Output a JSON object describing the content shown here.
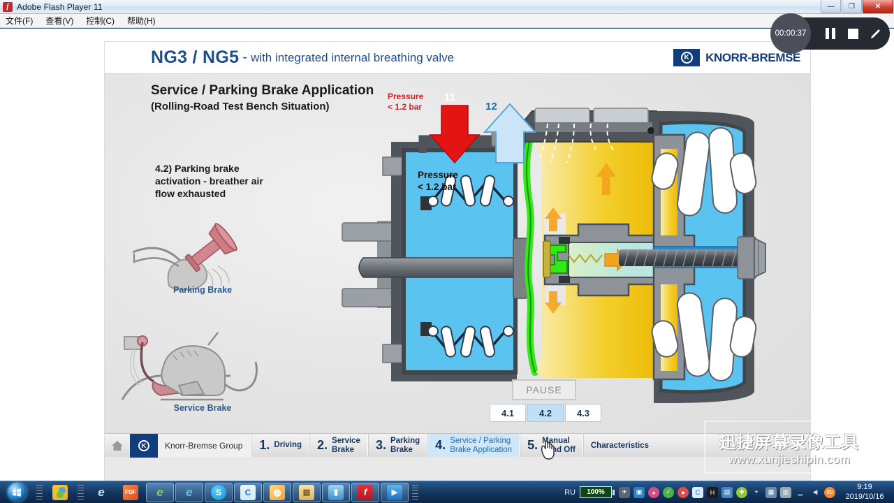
{
  "window": {
    "title": "Adobe Flash Player 11",
    "app_icon": "flash-icon",
    "minimize": "—",
    "maximize": "❐",
    "close": "✕",
    "menu": [
      "文件(F)",
      "查看(V)",
      "控制(C)",
      "帮助(H)"
    ]
  },
  "slide": {
    "header": {
      "ng": "NG3 / NG5",
      "dash": "-",
      "subtitle": "with integrated internal breathing valve",
      "brand_mark": "K",
      "brand_text": "KNORR-BREMSE"
    },
    "title_main": "Service / Parking Brake Application",
    "title_sub": "(Rolling-Road Test Bench Situation)",
    "note": "4.2) Parking brake activation - breather air flow exhausted",
    "parking_brake_label": "Parking Brake",
    "service_brake_label": "Service Brake",
    "pressure_red": "Pressure\n< 1.2 bar",
    "pressure_red_line1": "Pressure",
    "pressure_red_line2": "< 1.2 bar",
    "pressure_black_line1": "Pressure",
    "pressure_black_line2": "< 1.2 bar",
    "port_11": "11",
    "port_12": "12",
    "pause_label": "PAUSE",
    "subtabs": [
      {
        "label": "4.1",
        "active": false
      },
      {
        "label": "4.2",
        "active": true
      },
      {
        "label": "4.3",
        "active": false
      }
    ],
    "colors": {
      "header_blue": "#1f4e8c",
      "brand_blue": "#123d7c",
      "chamber_blue": "#5bc3f0",
      "chamber_yellow": "#f2c20c",
      "membrane_green": "#35e81a",
      "arrow_red": "#e21414",
      "arrow_blue": "#a8d8f5",
      "body_grey": "#5a6066"
    }
  },
  "navbar": {
    "home_icon": "home-icon",
    "brand_mark": "K",
    "brand": "Knorr-Bremse Group",
    "items": [
      {
        "num": "1.",
        "line1": "Driving",
        "line2": "",
        "active": false
      },
      {
        "num": "2.",
        "line1": "Service",
        "line2": "Brake",
        "active": false
      },
      {
        "num": "3.",
        "line1": "Parking",
        "line2": "Brake",
        "active": false
      },
      {
        "num": "4.",
        "line1": "Service / Parking",
        "line2": "Brake Application",
        "active": true
      },
      {
        "num": "5.",
        "line1": "Manual",
        "line2": "Wind Off",
        "active": false
      }
    ],
    "characteristics": "Characteristics"
  },
  "recorder": {
    "timer": "00:00:37",
    "pause_icon": "pause-icon",
    "stop_icon": "stop-icon",
    "pencil_icon": "pencil-icon"
  },
  "watermark": {
    "cn": "迅捷屏幕录像工具",
    "url": "www.xunjieshipin.com"
  },
  "taskbar": {
    "start_icon": "windows-start-orb",
    "items": [
      {
        "name": "taskbar-icon-norton",
        "glyph": "N",
        "color": "#f5c021",
        "open": false
      },
      {
        "name": "taskbar-icon-ie",
        "glyph": "e",
        "color": "#1a8fd1",
        "open": false
      },
      {
        "name": "taskbar-icon-pdf",
        "glyph": "PDF",
        "color": "#e8622a",
        "open": false
      },
      {
        "name": "taskbar-icon-browser1",
        "glyph": "e",
        "color": "#4cae3a",
        "open": true
      },
      {
        "name": "taskbar-icon-browser2",
        "glyph": "e",
        "color": "#3d9ad8",
        "open": true
      },
      {
        "name": "taskbar-icon-skype",
        "glyph": "S",
        "color": "#12a5e0",
        "open": true
      },
      {
        "name": "taskbar-icon-360",
        "glyph": "C",
        "color": "#1f6fc4",
        "open": true
      },
      {
        "name": "taskbar-icon-wechat",
        "glyph": "◍",
        "color": "#6fc93f",
        "open": true
      },
      {
        "name": "taskbar-icon-explorer",
        "glyph": "▤",
        "color": "#e0b24d",
        "open": true
      },
      {
        "name": "taskbar-icon-tool",
        "glyph": "▮",
        "color": "#4aa3dd",
        "open": true
      },
      {
        "name": "taskbar-icon-flash",
        "glyph": "f",
        "color": "#cf2127",
        "open": true
      },
      {
        "name": "taskbar-icon-recorder",
        "glyph": "▶",
        "color": "#2b8ad6",
        "open": true
      }
    ],
    "language": "RU",
    "battery": "100%",
    "time": "9:19",
    "date": "2019/10/16",
    "tray": [
      {
        "name": "tray-icon-satellite",
        "glyph": "✈",
        "color": "#5a6472"
      },
      {
        "name": "tray-icon-monitor",
        "glyph": "▣",
        "color": "#2d7fc4"
      },
      {
        "name": "tray-icon-qq",
        "glyph": "◕",
        "color": "#d84b8a"
      },
      {
        "name": "tray-icon-shield",
        "glyph": "✓",
        "color": "#4caf50"
      },
      {
        "name": "tray-icon-alert",
        "glyph": "●",
        "color": "#e04b4b"
      },
      {
        "name": "tray-icon-360safe",
        "glyph": "C",
        "color": "#8fd0f5"
      },
      {
        "name": "tray-icon-app",
        "glyph": "H",
        "color": "#222222"
      },
      {
        "name": "tray-icon-window",
        "glyph": "▤",
        "color": "#4a86c0"
      },
      {
        "name": "tray-icon-plus",
        "glyph": "✚",
        "color": "#8dc63f"
      },
      {
        "name": "tray-icon-bluetooth",
        "glyph": "✦",
        "color": "#2f6fd0"
      },
      {
        "name": "tray-icon-notes",
        "glyph": "▦",
        "color": "#6d8aa8"
      },
      {
        "name": "tray-icon-clipboard",
        "glyph": "▥",
        "color": "#9aa7b5"
      },
      {
        "name": "tray-icon-network",
        "glyph": "▁",
        "color": "#cfe4f7"
      },
      {
        "name": "tray-icon-volume",
        "glyph": "◀",
        "color": "#cfe4f7"
      },
      {
        "name": "tray-icon-counter",
        "glyph": "89",
        "color": "#f08a2b"
      }
    ]
  }
}
